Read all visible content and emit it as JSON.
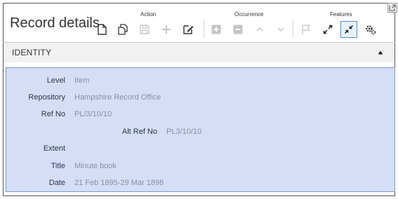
{
  "header": {
    "title": "Record details",
    "groups": {
      "action": "Action",
      "occurrence": "Occurrence",
      "features": "Features"
    }
  },
  "section": {
    "title": "IDENTITY"
  },
  "fields": {
    "level": {
      "label": "Level",
      "value": "Item"
    },
    "repository": {
      "label": "Repository",
      "value": "Hampshire Record Office"
    },
    "ref_no": {
      "label": "Ref No",
      "value": "PL/3/10/10"
    },
    "alt_ref_no": {
      "label": "Alt Ref No",
      "value": "PL3/10/10"
    },
    "extent": {
      "label": "Extent",
      "value": ""
    },
    "title": {
      "label": "Title",
      "value": "Minute book"
    },
    "date": {
      "label": "Date",
      "value": "21 Feb 1895-29 Mar 1898"
    }
  },
  "icons": {
    "action": [
      "new-document-icon",
      "copy-icon",
      "save-icon",
      "add-icon",
      "edit-icon"
    ],
    "occurrence": [
      "add-occurrence-icon",
      "remove-occurrence-icon",
      "chevron-up-icon",
      "chevron-down-icon"
    ],
    "features": [
      "flag-icon",
      "expand-icon",
      "collapse-icon",
      "settings-icon"
    ],
    "popout": "popout-icon"
  },
  "colors": {
    "panel_bg": "#d5def6",
    "panel_border": "#8098c8",
    "selected_border": "#4a8fd6"
  }
}
